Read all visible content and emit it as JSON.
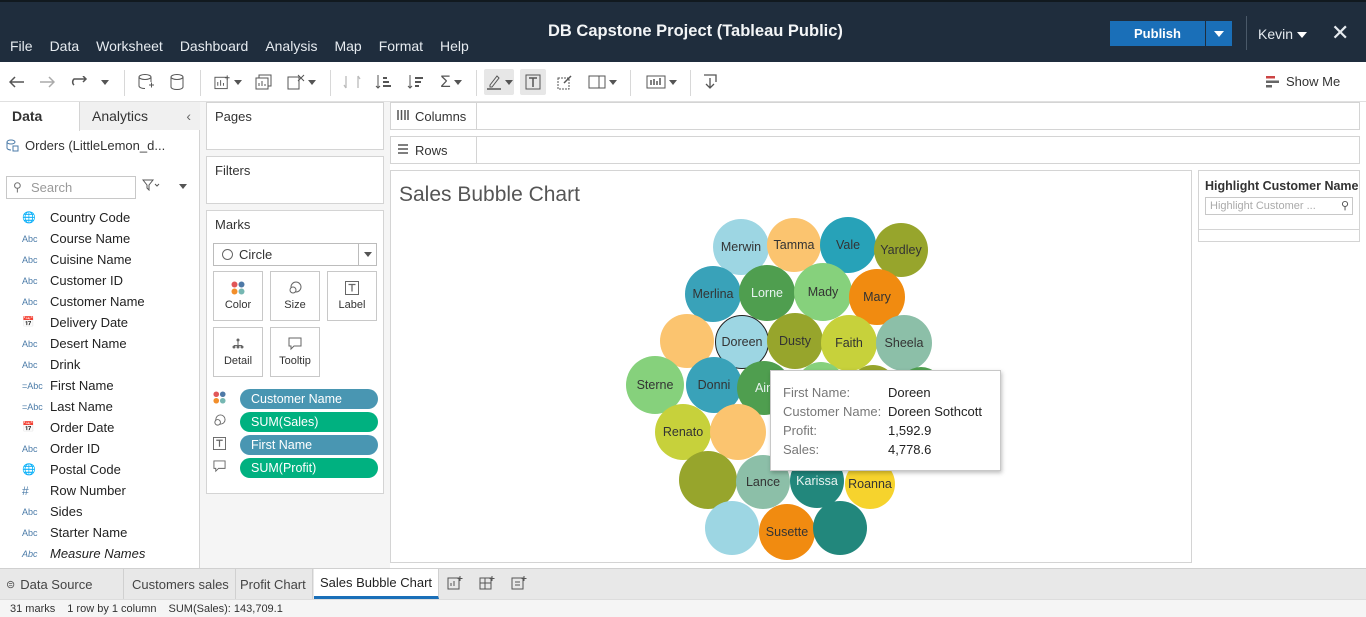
{
  "app": {
    "title": "DB Capstone Project (Tableau Public)",
    "menu": [
      "File",
      "Data",
      "Worksheet",
      "Dashboard",
      "Analysis",
      "Map",
      "Format",
      "Help"
    ],
    "publish_label": "Publish",
    "user": "Kevin",
    "close_glyph": "✕"
  },
  "toolbar": {
    "show_me_label": "Show Me"
  },
  "data_pane": {
    "tab_data": "Data",
    "tab_analytics": "Analytics",
    "data_source": "Orders (LittleLemon_d...",
    "search_placeholder": "Search",
    "fields": [
      {
        "icon": "globe",
        "name": "Country Code",
        "italic": false
      },
      {
        "icon": "Abc",
        "name": "Course Name",
        "italic": false
      },
      {
        "icon": "Abc",
        "name": "Cuisine Name",
        "italic": false
      },
      {
        "icon": "Abc",
        "name": "Customer ID",
        "italic": false
      },
      {
        "icon": "Abc",
        "name": "Customer Name",
        "italic": false
      },
      {
        "icon": "calendar",
        "name": "Delivery Date",
        "italic": false
      },
      {
        "icon": "Abc",
        "name": "Desert Name",
        "italic": false
      },
      {
        "icon": "Abc",
        "name": "Drink",
        "italic": false
      },
      {
        "icon": "=Abc",
        "name": "First Name",
        "italic": false
      },
      {
        "icon": "=Abc",
        "name": "Last Name",
        "italic": false
      },
      {
        "icon": "calendar",
        "name": "Order Date",
        "italic": false
      },
      {
        "icon": "Abc",
        "name": "Order ID",
        "italic": false
      },
      {
        "icon": "globe",
        "name": "Postal Code",
        "italic": false
      },
      {
        "icon": "#",
        "name": "Row Number",
        "italic": false
      },
      {
        "icon": "Abc",
        "name": "Sides",
        "italic": false
      },
      {
        "icon": "Abc",
        "name": "Starter Name",
        "italic": false
      },
      {
        "icon": "Abc",
        "name": "Measure Names",
        "italic": true
      }
    ]
  },
  "cards": {
    "pages_title": "Pages",
    "filters_title": "Filters",
    "marks_title": "Marks",
    "mark_type": "Circle",
    "buttons": {
      "color": "Color",
      "size": "Size",
      "label": "Label",
      "detail": "Detail",
      "tooltip": "Tooltip"
    },
    "pills": [
      {
        "icon": "color-dots",
        "text": "Customer Name",
        "kind": "dim"
      },
      {
        "icon": "size",
        "text": "SUM(Sales)",
        "kind": "meas"
      },
      {
        "icon": "label",
        "text": "First Name",
        "kind": "dim"
      },
      {
        "icon": "tooltip",
        "text": "SUM(Profit)",
        "kind": "meas"
      }
    ]
  },
  "shelves": {
    "columns_label": "Columns",
    "rows_label": "Rows"
  },
  "viz": {
    "title": "Sales Bubble Chart",
    "bubbles": [
      {
        "label": "Merwin",
        "color": "#9dd6e3"
      },
      {
        "label": "Tamma",
        "color": "#fbc46f"
      },
      {
        "label": "Vale",
        "color": "#27a2b8"
      },
      {
        "label": "Yardley",
        "color": "#97a52c"
      },
      {
        "label": "Merlina",
        "color": "#39a2b9"
      },
      {
        "label": "Lorne",
        "color": "#4f9e4f"
      },
      {
        "label": "Mady",
        "color": "#86d17c"
      },
      {
        "label": "Mary",
        "color": "#f18b10"
      },
      {
        "label": "",
        "color": "#fbc46f"
      },
      {
        "label": "Doreen",
        "color": "#9dd6e3"
      },
      {
        "label": "Dusty",
        "color": "#97a52c"
      },
      {
        "label": "Faith",
        "color": "#c7d13b"
      },
      {
        "label": "Sheela",
        "color": "#8cbfa8"
      },
      {
        "label": "Sterne",
        "color": "#86d17c"
      },
      {
        "label": "Donni",
        "color": "#39a2b9"
      },
      {
        "label": "Ain",
        "color": "#4f9e4f"
      },
      {
        "label": "Renato",
        "color": "#c7d13b"
      },
      {
        "label": "",
        "color": "#fbc46f"
      },
      {
        "label": "",
        "color": "#97a52c"
      },
      {
        "label": "Lance",
        "color": "#8cbfa8"
      },
      {
        "label": "Karissa",
        "color": "#22877c"
      },
      {
        "label": "Roanna",
        "color": "#f6d32d"
      },
      {
        "label": "",
        "color": "#9dd6e3"
      },
      {
        "label": "Susette",
        "color": "#f18b10"
      },
      {
        "label": "",
        "color": "#22877c"
      },
      {
        "label": "",
        "color": "#86d17c"
      },
      {
        "label": "",
        "color": "#97a52c"
      },
      {
        "label": "",
        "color": "#f18b10"
      },
      {
        "label": "",
        "color": "#4f9e4f"
      }
    ],
    "tooltip": {
      "rows": [
        {
          "k": "First Name:",
          "v": "Doreen"
        },
        {
          "k": "Customer Name:",
          "v": "Doreen Sothcott"
        },
        {
          "k": "Profit:",
          "v": "1,592.9"
        },
        {
          "k": "Sales:",
          "v": "4,778.6"
        }
      ]
    }
  },
  "legend": {
    "title": "Highlight Customer Name",
    "placeholder": "Highlight Customer ..."
  },
  "sheet_tabs": {
    "data_source": "Data Source",
    "sheets": [
      "Customers sales",
      "Profit Chart",
      "Sales Bubble Chart"
    ],
    "active": "Sales Bubble Chart"
  },
  "status": {
    "marks": "31 marks",
    "dims": "1 row by 1 column",
    "sum": "SUM(Sales): 143,709.1"
  }
}
